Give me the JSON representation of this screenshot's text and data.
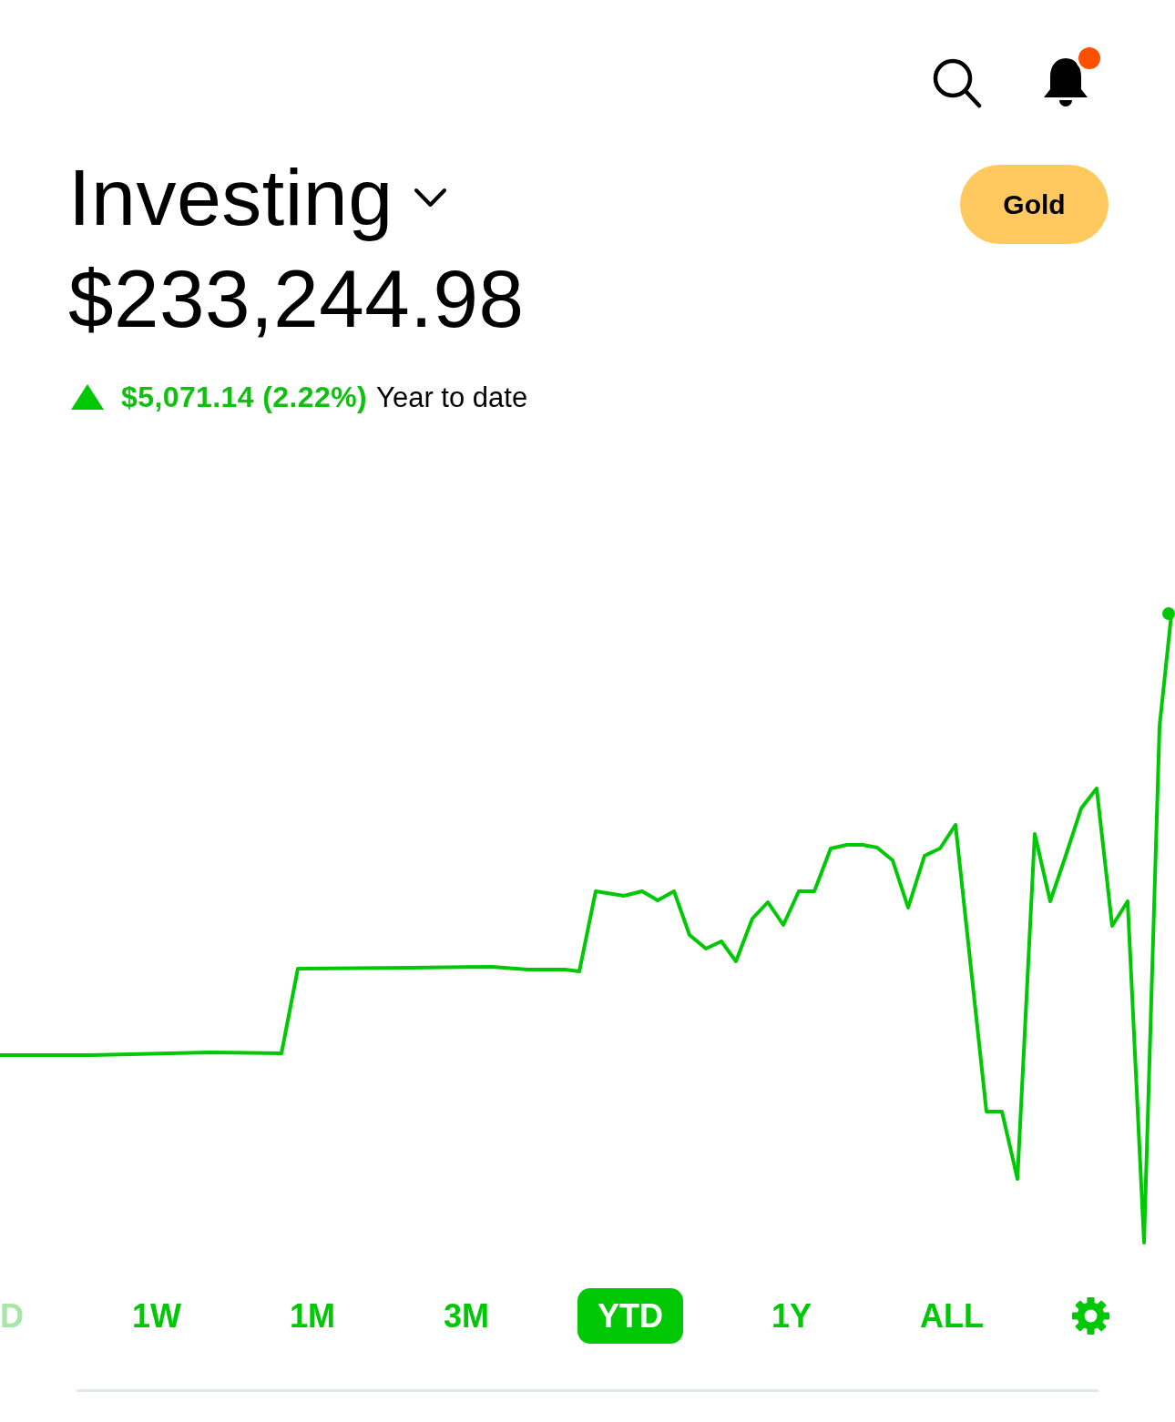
{
  "header": {
    "notifications": {
      "unread": true
    },
    "account": {
      "title": "Investing"
    },
    "badge": "Gold"
  },
  "portfolio": {
    "value": "$233,244.98",
    "change": {
      "positive": true,
      "amount": "$5,071.14 (2.22%)",
      "period": "Year to date"
    }
  },
  "time_ranges": [
    {
      "label": "D",
      "selected": false
    },
    {
      "label": "1W",
      "selected": false
    },
    {
      "label": "1M",
      "selected": false
    },
    {
      "label": "3M",
      "selected": false
    },
    {
      "label": "YTD",
      "selected": true
    },
    {
      "label": "1Y",
      "selected": false
    },
    {
      "label": "ALL",
      "selected": false
    }
  ]
}
